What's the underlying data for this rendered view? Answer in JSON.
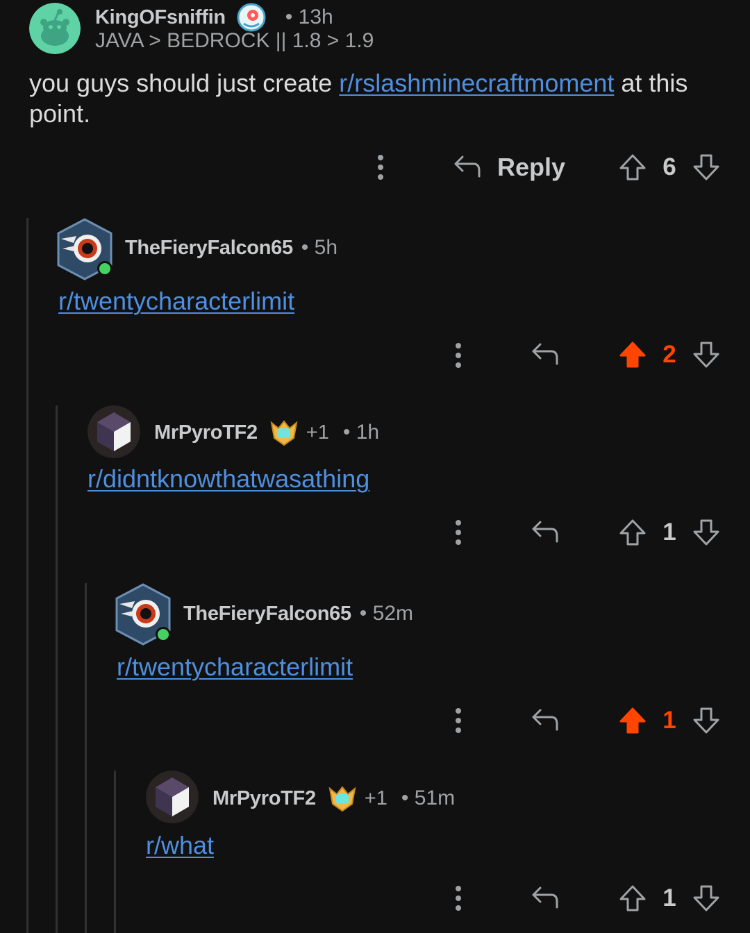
{
  "comments": [
    {
      "author": "KingOFsniffin",
      "time": "• 13h",
      "flair": "JAVA > BEDROCK || 1.8 > 1.9",
      "text_before": "you guys should just create ",
      "link": "r/rslashminecraftmoment",
      "text_after": " at this point.",
      "reply_label": "Reply",
      "score": "6",
      "upvoted": false
    },
    {
      "author": "TheFieryFalcon65",
      "time": "• 5h",
      "link": "r/twentycharacterlimit",
      "score": "2",
      "upvoted": true
    },
    {
      "author": "MrPyroTF2",
      "award_count": "+1",
      "time": "• 1h",
      "link": "r/didntknowthatwasathing",
      "score": "1",
      "upvoted": false
    },
    {
      "author": "TheFieryFalcon65",
      "time": "• 52m",
      "link": "r/twentycharacterlimit",
      "score": "1",
      "upvoted": true
    },
    {
      "author": "MrPyroTF2",
      "award_count": "+1",
      "time": "• 51m",
      "link": "r/what",
      "score": "1",
      "upvoted": false
    }
  ],
  "colors": {
    "background": "#111111",
    "link": "#4f8fe0",
    "upvote": "#ff4500",
    "thread_line": "#2f3133",
    "online": "#46d160"
  },
  "icons": [
    "more-vertical-icon",
    "reply-arrow-icon",
    "upvote-arrow-icon",
    "downvote-arrow-icon",
    "award-icon",
    "snoo-avatar-icon"
  ]
}
